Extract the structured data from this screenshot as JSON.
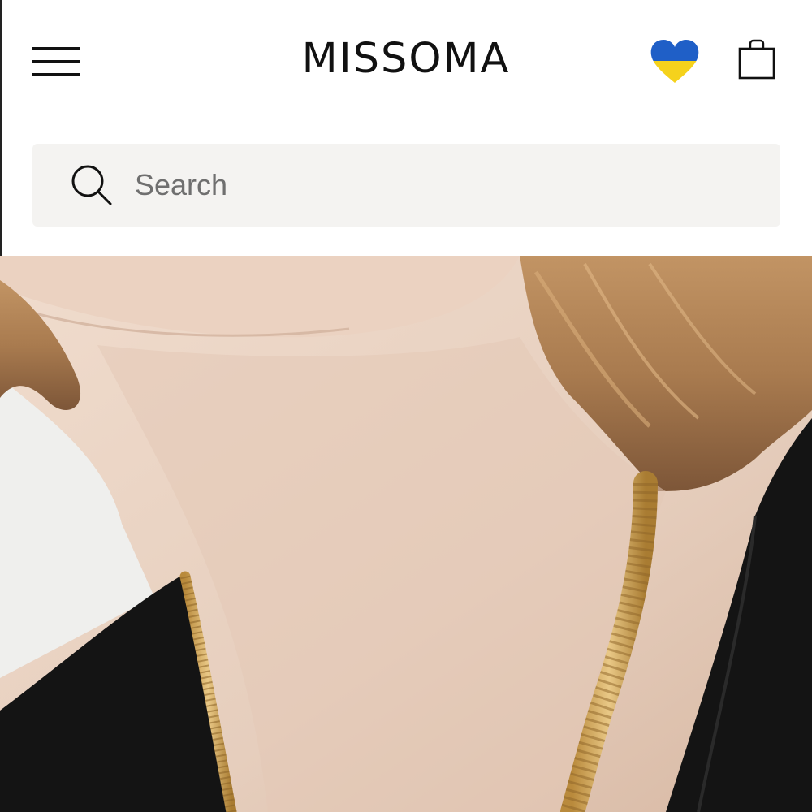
{
  "header": {
    "brand": "MISSOMA",
    "menu_icon": "hamburger-menu-icon",
    "support_icon": "ukraine-heart-icon",
    "cart_icon": "shopping-bag-icon"
  },
  "search": {
    "placeholder": "Search",
    "value": "",
    "icon": "search-icon"
  },
  "colors": {
    "heart_top": "#1f5fc7",
    "heart_bottom": "#f5d21c",
    "search_background": "#f4f3f1",
    "text": "#111111"
  }
}
